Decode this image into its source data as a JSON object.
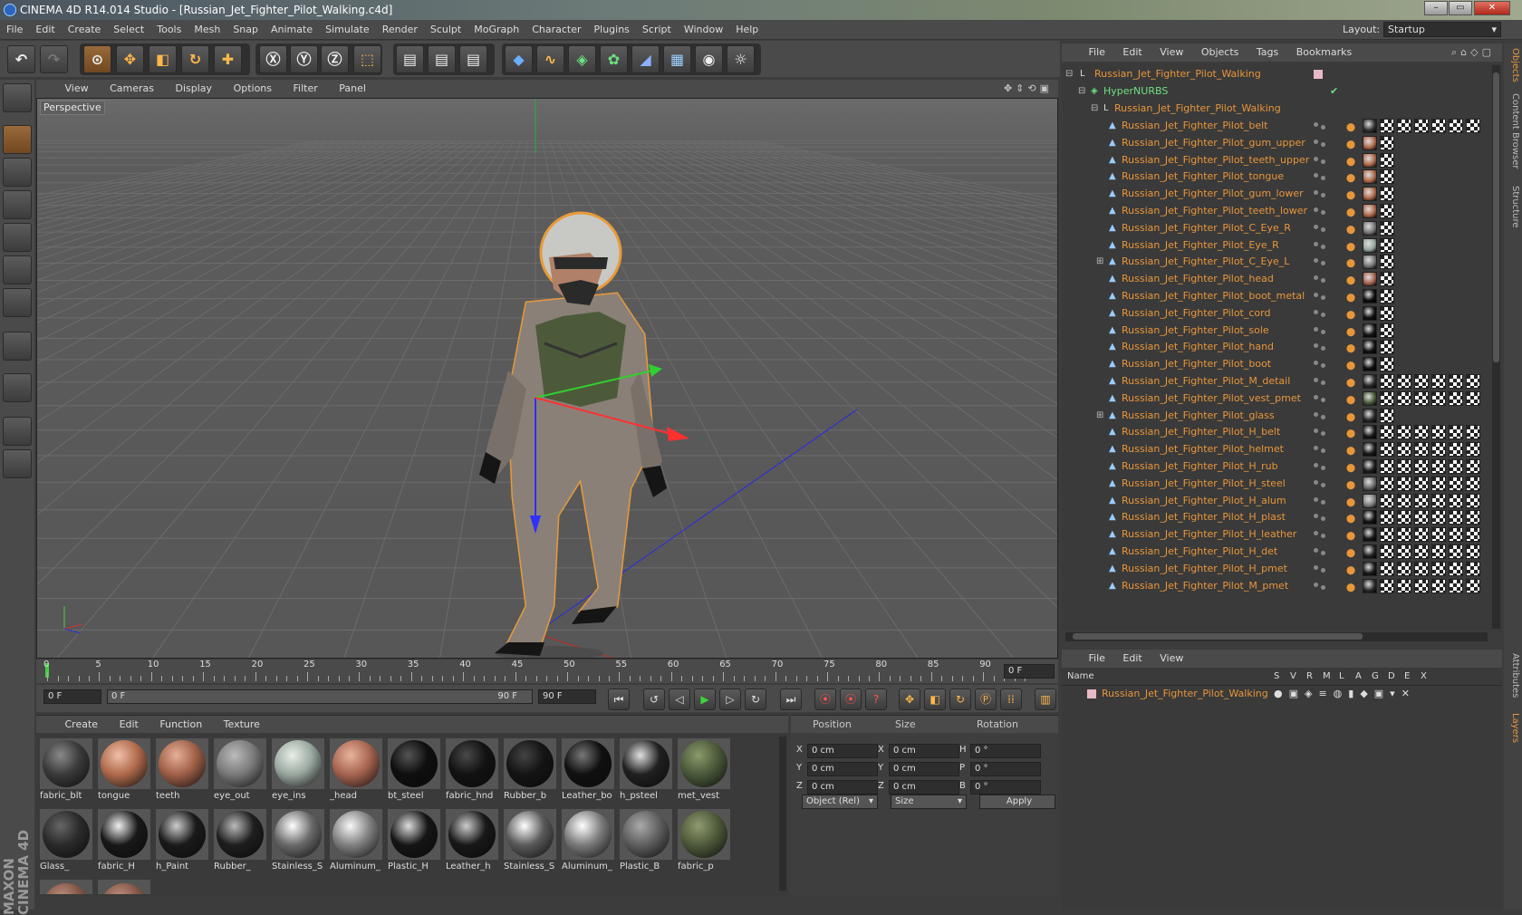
{
  "window": {
    "title": "CINEMA 4D R14.014 Studio - [Russian_Jet_Fighter_Pilot_Walking.c4d]"
  },
  "menubar": [
    "File",
    "Edit",
    "Create",
    "Select",
    "Tools",
    "Mesh",
    "Snap",
    "Animate",
    "Simulate",
    "Render",
    "Sculpt",
    "MoGraph",
    "Character",
    "Plugins",
    "Script",
    "Window",
    "Help"
  ],
  "layout": {
    "label": "Layout:",
    "value": "Startup"
  },
  "viewport": {
    "menu": [
      "View",
      "Cameras",
      "Display",
      "Options",
      "Filter",
      "Panel"
    ],
    "label": "Perspective"
  },
  "timeline": {
    "ticks": [
      "0",
      "5",
      "10",
      "15",
      "20",
      "25",
      "30",
      "35",
      "40",
      "45",
      "50",
      "55",
      "60",
      "65",
      "70",
      "75",
      "80",
      "85",
      "90"
    ],
    "current": "0 F",
    "start": "0 F",
    "range_start": "0 F",
    "range_end": "90 F",
    "end": "90 F"
  },
  "materials": {
    "menu": [
      "Create",
      "Edit",
      "Function",
      "Texture"
    ],
    "items": [
      {
        "label": "fabric_blt",
        "color": "#3a3a3a",
        "hl": "#8a8a8a"
      },
      {
        "label": "tongue",
        "color": "#b06a4c",
        "hl": "#f0c0a8"
      },
      {
        "label": "teeth",
        "color": "#a06048",
        "hl": "#e8b098"
      },
      {
        "label": "eye_out",
        "color": "#7a7a7a",
        "hl": "#bbbbbb"
      },
      {
        "label": "eye_ins",
        "color": "#9aa8a0",
        "hl": "#e8eee8"
      },
      {
        "label": "_head",
        "color": "#a86450",
        "hl": "#e8b49c"
      },
      {
        "label": "bt_steel",
        "color": "#0e0e0e",
        "hl": "#555555"
      },
      {
        "label": "fabric_hnd",
        "color": "#121212",
        "hl": "#4a4a4a"
      },
      {
        "label": "Rubber_b",
        "color": "#141414",
        "hl": "#444444"
      },
      {
        "label": "Leather_bo",
        "color": "#101010",
        "hl": "#777777"
      },
      {
        "label": "h_psteel",
        "color": "#202020",
        "hl": "#e0e0e0"
      },
      {
        "label": "met_vest",
        "color": "#4a5a3a",
        "hl": "#8a9a6a"
      },
      {
        "label": "Glass_",
        "color": "#2a2a2a",
        "hl": "#666666"
      },
      {
        "label": "fabric_H",
        "color": "#181818",
        "hl": "#f0f0f0"
      },
      {
        "label": "h_Paint",
        "color": "#1a1a1a",
        "hl": "#cccccc"
      },
      {
        "label": "Rubber_",
        "color": "#1e1e1e",
        "hl": "#bbbbbb"
      },
      {
        "label": "Stainless_S",
        "color": "#6a6a6a",
        "hl": "#ffffff"
      },
      {
        "label": "Aluminum_",
        "color": "#808080",
        "hl": "#f8f8f8"
      },
      {
        "label": "Plastic_H",
        "color": "#151515",
        "hl": "#dddddd"
      },
      {
        "label": "Leather_h",
        "color": "#181818",
        "hl": "#cccccc"
      },
      {
        "label": "Stainless_S",
        "color": "#5a5a5a",
        "hl": "#ffffff"
      },
      {
        "label": "Aluminum_",
        "color": "#7a7a7a",
        "hl": "#ffffff"
      },
      {
        "label": "Plastic_B",
        "color": "#5e5e5e",
        "hl": "#aaaaaa"
      },
      {
        "label": "fabric_p",
        "color": "#4e5a3a",
        "hl": "#909a70"
      }
    ]
  },
  "coords": {
    "headers": [
      "Position",
      "Size",
      "Rotation"
    ],
    "rows": [
      {
        "axis": "X",
        "pos": "0 cm",
        "saxis": "X",
        "size": "0 cm",
        "raxis": "H",
        "rot": "0 °"
      },
      {
        "axis": "Y",
        "pos": "0 cm",
        "saxis": "Y",
        "size": "0 cm",
        "raxis": "P",
        "rot": "0 °"
      },
      {
        "axis": "Z",
        "pos": "0 cm",
        "saxis": "Z",
        "size": "0 cm",
        "raxis": "B",
        "rot": "0 °"
      }
    ],
    "mode": "Object (Rel)",
    "size_mode": "Size",
    "apply": "Apply"
  },
  "objects": {
    "menu": [
      "File",
      "Edit",
      "View",
      "Objects",
      "Tags",
      "Bookmarks"
    ],
    "root": "Russian_Jet_Fighter_Pilot_Walking",
    "hypernurbs": "HyperNURBS",
    "group": "Russian_Jet_Fighter_Pilot_Walking",
    "items": [
      {
        "name": "Russian_Jet_Fighter_Pilot_belt",
        "mat": "#333",
        "n": 7
      },
      {
        "name": "Russian_Jet_Fighter_Pilot_gum_upper",
        "mat": "#b06a4c",
        "n": 2
      },
      {
        "name": "Russian_Jet_Fighter_Pilot_teeth_upper",
        "mat": "#b06a4c",
        "n": 2
      },
      {
        "name": "Russian_Jet_Fighter_Pilot_tongue",
        "mat": "#b06a4c",
        "n": 2
      },
      {
        "name": "Russian_Jet_Fighter_Pilot_gum_lower",
        "mat": "#b06a4c",
        "n": 2
      },
      {
        "name": "Russian_Jet_Fighter_Pilot_teeth_lower",
        "mat": "#b06a4c",
        "n": 2
      },
      {
        "name": "Russian_Jet_Fighter_Pilot_C_Eye_R",
        "mat": "#777",
        "n": 2
      },
      {
        "name": "Russian_Jet_Fighter_Pilot_Eye_R",
        "mat": "#9aa8a0",
        "n": 2
      },
      {
        "name": "Russian_Jet_Fighter_Pilot_C_Eye_L",
        "mat": "#777",
        "n": 2
      },
      {
        "name": "Russian_Jet_Fighter_Pilot_head",
        "mat": "#a86450",
        "n": 2
      },
      {
        "name": "Russian_Jet_Fighter_Pilot_boot_metal",
        "mat": "#0e0e0e",
        "n": 2
      },
      {
        "name": "Russian_Jet_Fighter_Pilot_cord",
        "mat": "#111",
        "n": 2
      },
      {
        "name": "Russian_Jet_Fighter_Pilot_sole",
        "mat": "#141414",
        "n": 2
      },
      {
        "name": "Russian_Jet_Fighter_Pilot_hand",
        "mat": "#121212",
        "n": 2
      },
      {
        "name": "Russian_Jet_Fighter_Pilot_boot",
        "mat": "#101010",
        "n": 2
      },
      {
        "name": "Russian_Jet_Fighter_Pilot_M_detail",
        "mat": "#2a2a2a",
        "n": 7
      },
      {
        "name": "Russian_Jet_Fighter_Pilot_vest_pmet",
        "mat": "#4a5a3a",
        "n": 7
      },
      {
        "name": "Russian_Jet_Fighter_Pilot_glass",
        "mat": "#2a2a2a",
        "n": 2
      },
      {
        "name": "Russian_Jet_Fighter_Pilot_H_belt",
        "mat": "#181818",
        "n": 7
      },
      {
        "name": "Russian_Jet_Fighter_Pilot_helmet",
        "mat": "#1a1a1a",
        "n": 7
      },
      {
        "name": "Russian_Jet_Fighter_Pilot_H_rub",
        "mat": "#1e1e1e",
        "n": 7
      },
      {
        "name": "Russian_Jet_Fighter_Pilot_H_steel",
        "mat": "#6a6a6a",
        "n": 7
      },
      {
        "name": "Russian_Jet_Fighter_Pilot_H_alum",
        "mat": "#808080",
        "n": 7
      },
      {
        "name": "Russian_Jet_Fighter_Pilot_H_plast",
        "mat": "#151515",
        "n": 7
      },
      {
        "name": "Russian_Jet_Fighter_Pilot_H_leather",
        "mat": "#181818",
        "n": 7
      },
      {
        "name": "Russian_Jet_Fighter_Pilot_H_det",
        "mat": "#202020",
        "n": 7
      },
      {
        "name": "Russian_Jet_Fighter_Pilot_H_pmet",
        "mat": "#1a1a1a",
        "n": 7
      },
      {
        "name": "Russian_Jet_Fighter_Pilot_M_pmet",
        "mat": "#2a2a2a",
        "n": 7
      }
    ]
  },
  "layers": {
    "menu": [
      "File",
      "Edit",
      "View"
    ],
    "columns": [
      "Name",
      "S",
      "V",
      "R",
      "M",
      "L",
      "A",
      "G",
      "D",
      "E",
      "X"
    ],
    "row": "Russian_Jet_Fighter_Pilot_Walking"
  },
  "right_tabs": [
    "Objects",
    "Content Browser",
    "Structure",
    "Attributes",
    "Layers"
  ],
  "maxon": "MAXON CINEMA 4D",
  "colors": {
    "accent": "#e8963a",
    "selection": "#d8903a"
  }
}
